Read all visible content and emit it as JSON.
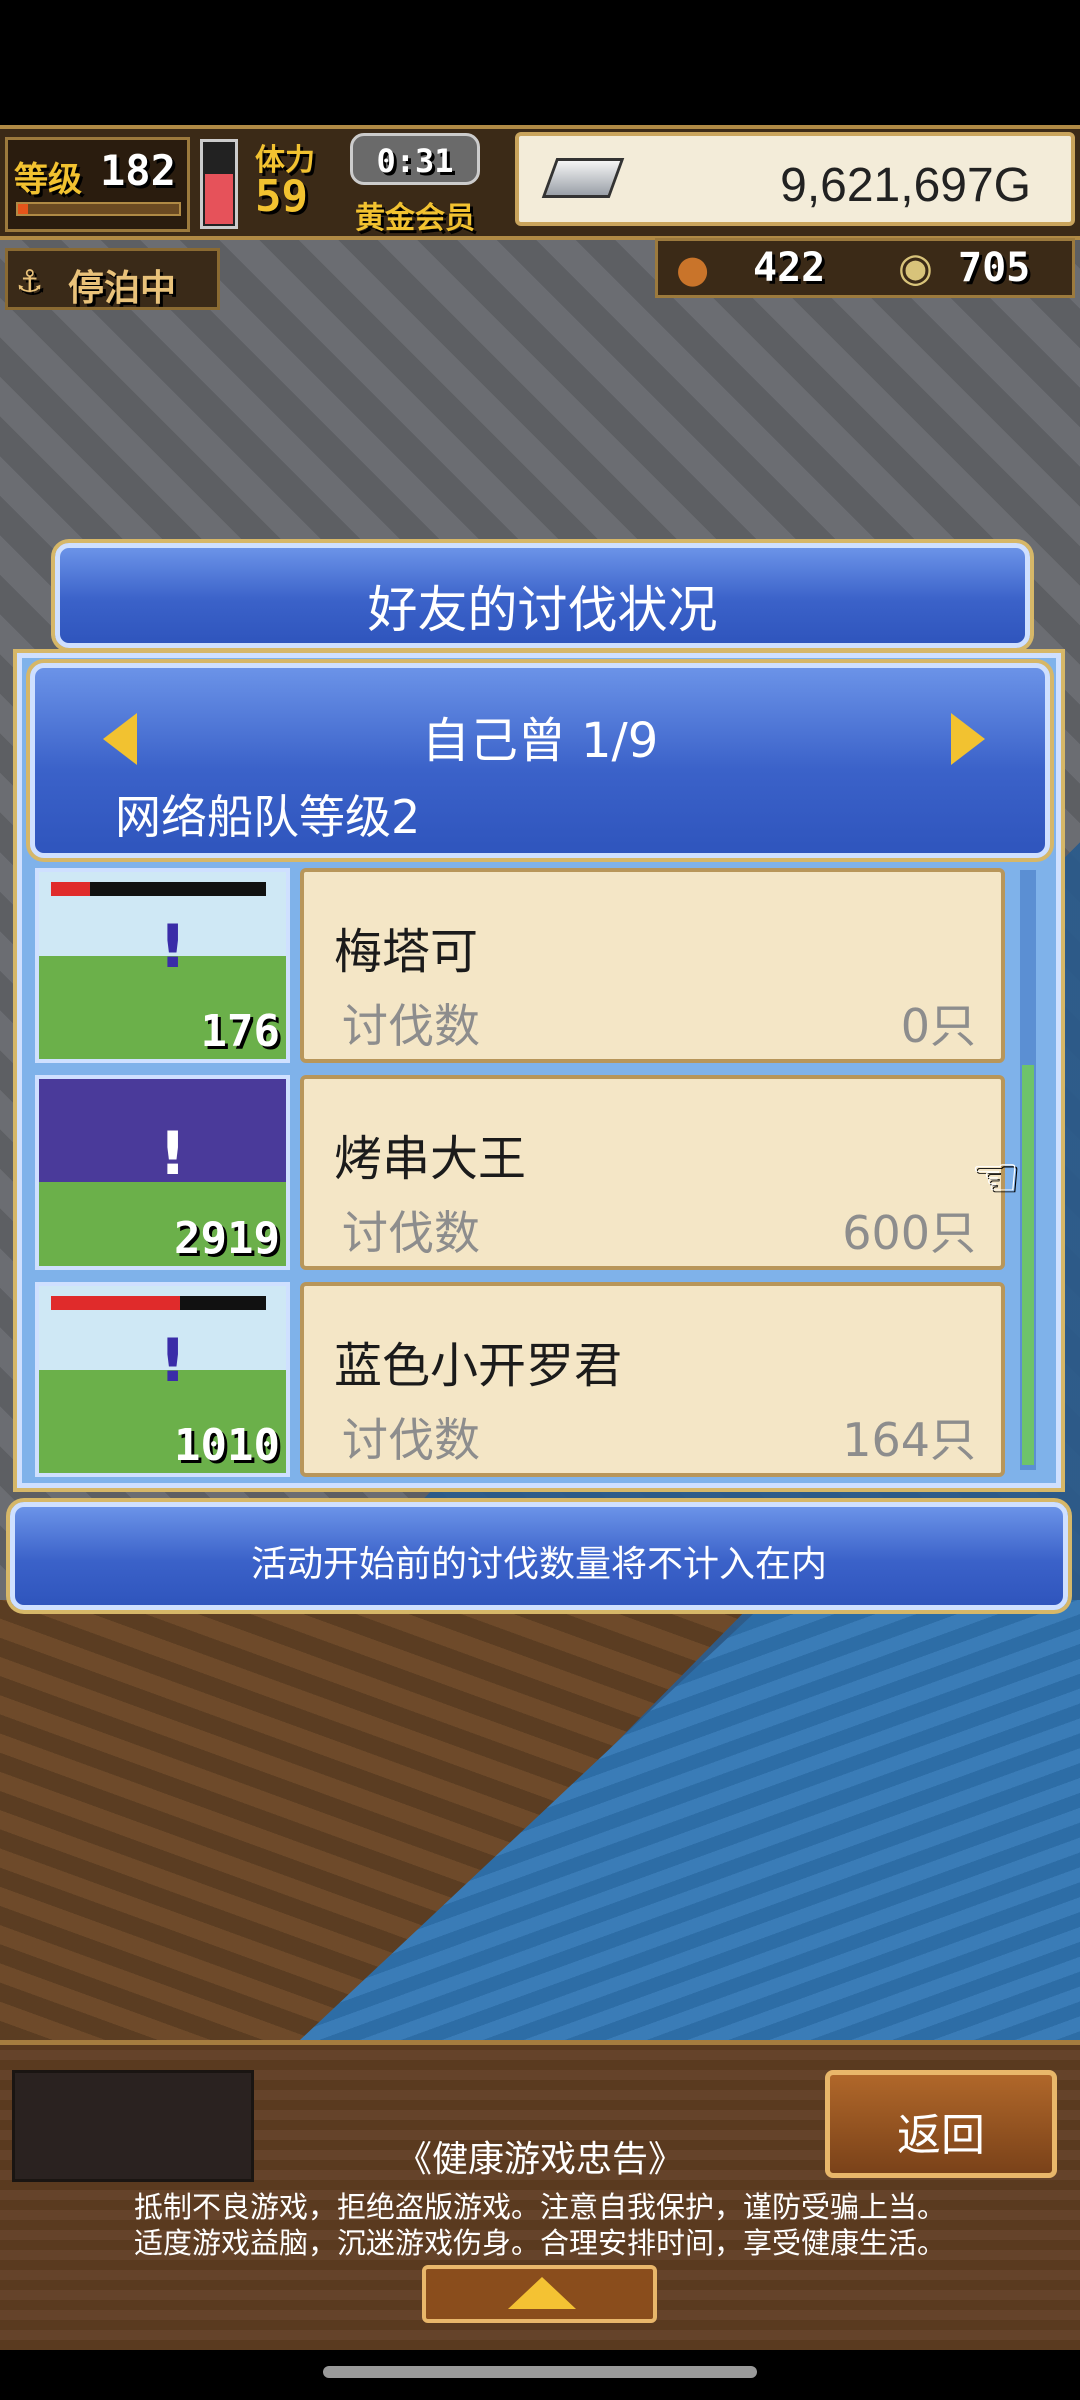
{
  "hud": {
    "level_label": "等级",
    "level_value": "182",
    "stamina_label": "体力",
    "stamina_value": "59",
    "timer": "0:31",
    "membership": "黄金会员",
    "gold": "9,621,697G",
    "resource_1": "422",
    "resource_2": "705",
    "status": "停泊中"
  },
  "dialog": {
    "title": "好友的讨伐状况",
    "friend_name": "自己曾 1/9",
    "fleet_level": "网络船队等级2",
    "rows": [
      {
        "name": "梅塔可",
        "count_label": "讨伐数",
        "count": "0只",
        "thumb_number": "176",
        "hp_fraction": 0.18
      },
      {
        "name": "烤串大王",
        "count_label": "讨伐数",
        "count": "600只",
        "thumb_number": "2919",
        "hp_fraction": 0.0
      },
      {
        "name": "蓝色小开罗君",
        "count_label": "讨伐数",
        "count": "164只",
        "thumb_number": "1010",
        "hp_fraction": 0.6
      }
    ],
    "notice": "活动开始前的讨伐数量将不计入在内"
  },
  "bottom": {
    "back_label": "返回",
    "advice_title": "《健康游戏忠告》",
    "advice_line_1": "抵制不良游戏，拒绝盗版游戏。注意自我保护，谨防受骗上当。",
    "advice_line_2": "适度游戏益脑，沉迷游戏伤身。合理安排时间，享受健康生活。"
  },
  "colors": {
    "panel_blue": "#3b62c9",
    "card_bg": "#f4e6c6",
    "gold_accent": "#f2c230"
  }
}
